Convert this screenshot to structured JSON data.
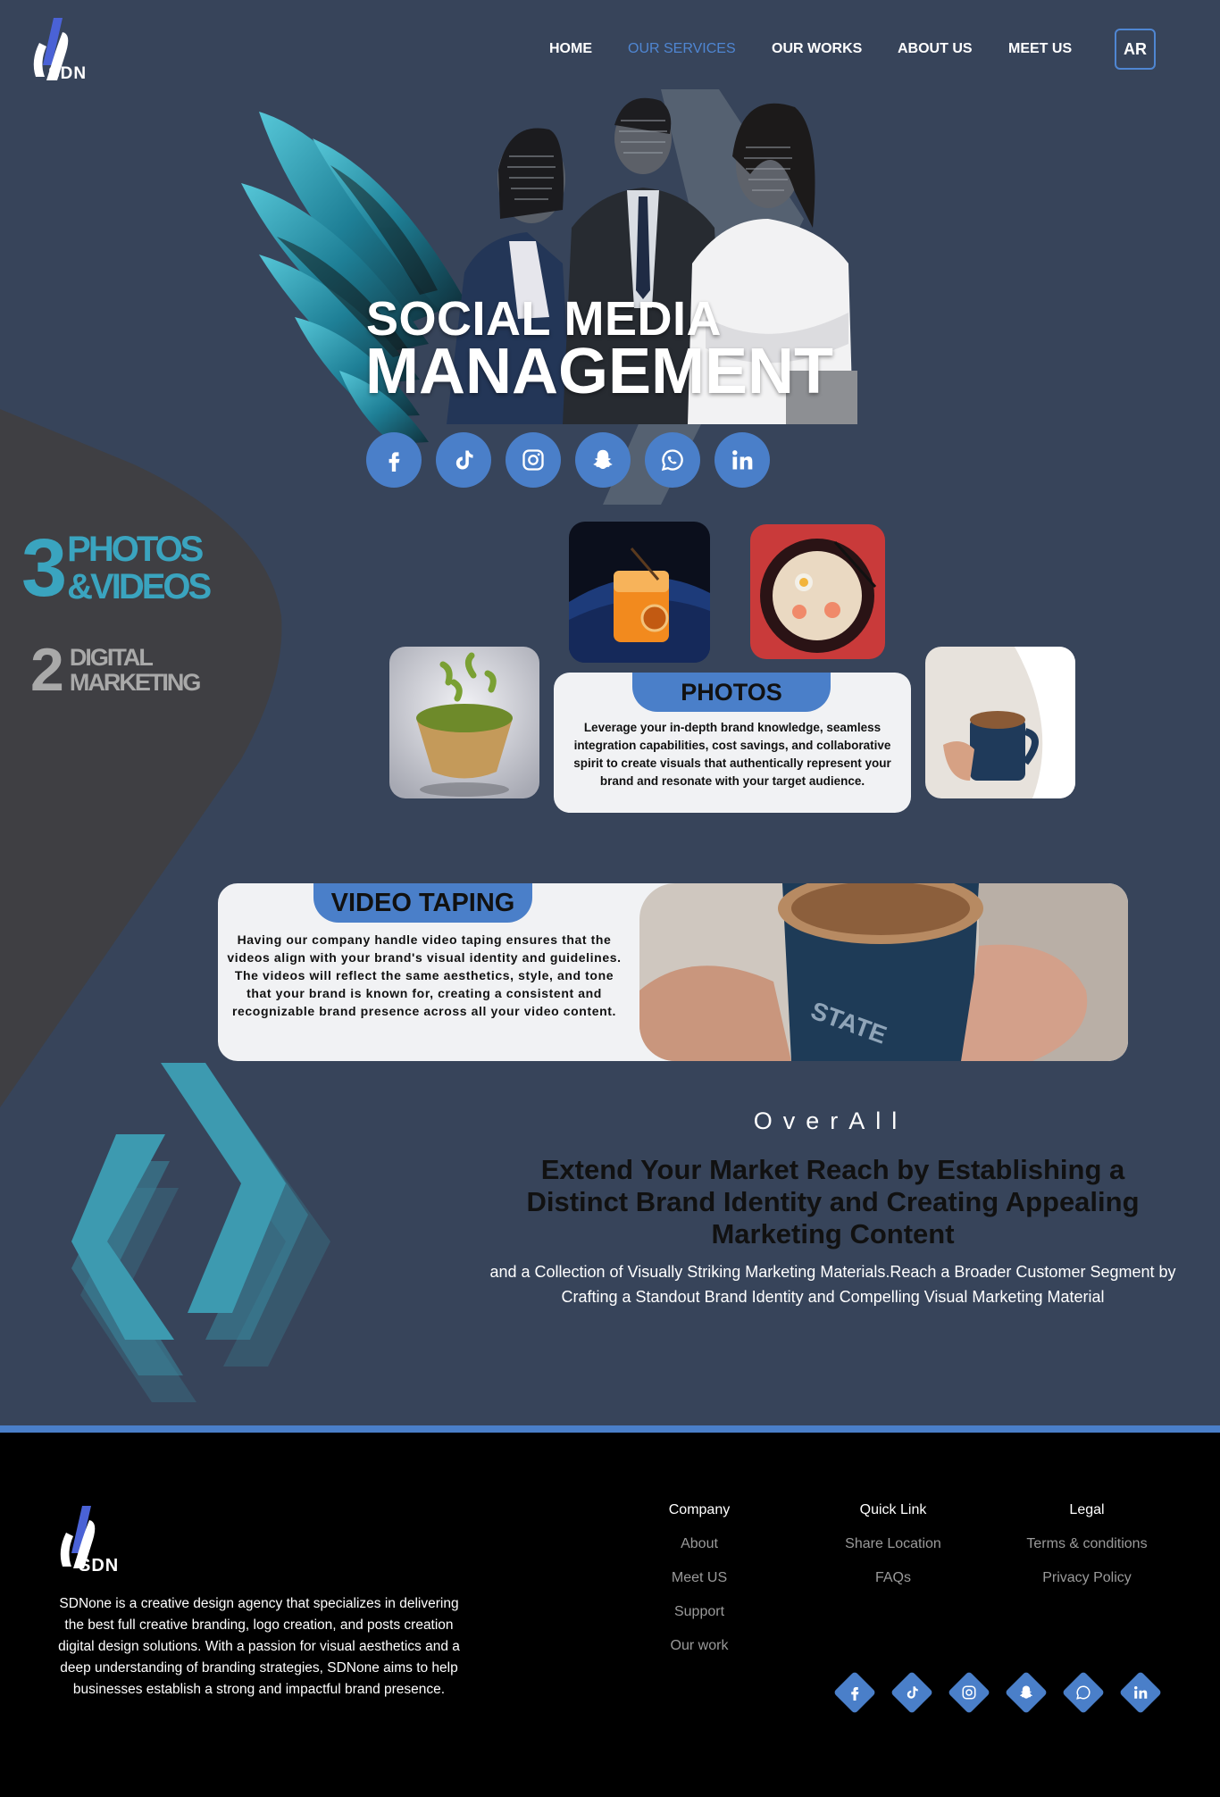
{
  "brand": {
    "logo_text": "SDN"
  },
  "nav": {
    "items": [
      "HOME",
      "OUR SERVICES",
      "OUR WORKS",
      "ABOUT US",
      "MEET US"
    ],
    "active": "OUR SERVICES",
    "lang_button": "AR"
  },
  "hero": {
    "title_line1": "SOCIAL MEDIA",
    "title_line2": "MANAGEMENT",
    "social_icons": [
      "facebook-icon",
      "tiktok-icon",
      "instagram-icon",
      "snapchat-icon",
      "whatsapp-icon",
      "linkedin-icon"
    ]
  },
  "counters": [
    {
      "number": "3",
      "label_line1": "PHOTOS",
      "label_line2": "&VIDEOS"
    },
    {
      "number": "2",
      "label_line1": "DIGITAL",
      "label_line2": "MARKETING"
    }
  ],
  "photos": {
    "title": "PHOTOS",
    "text": "Leverage your in-depth brand knowledge, seamless integration capabilities, cost savings, and collaborative spirit to create visuals that authentically represent your brand and resonate with your target audience."
  },
  "video": {
    "title": "VIDEO TAPING",
    "text": "Having our company handle video taping ensures that the videos align with your brand's visual identity and guidelines. The videos will reflect the same aesthetics, style, and tone that your brand is known for, creating a consistent and recognizable brand presence across all your video content."
  },
  "overall": {
    "kicker": "OverAll",
    "heading": "Extend Your Market Reach by Establishing a Distinct Brand Identity and Creating Appealing Marketing Content",
    "body": "and a Collection of Visually Striking Marketing Materials.Reach a Broader Customer Segment by Crafting a Standout Brand Identity and Compelling Visual Marketing Material"
  },
  "footer": {
    "logo_text": "SDN",
    "about": "SDNone is a creative design agency that specializes in delivering the best full creative branding, logo creation, and posts creation digital design solutions. With a passion for visual aesthetics and a deep understanding of branding strategies, SDNone aims to help businesses establish a strong and impactful brand presence.",
    "company": {
      "heading": "Company",
      "links": [
        "About",
        "Meet US",
        "Support",
        "Our work"
      ]
    },
    "quick": {
      "heading": "Quick Link",
      "links": [
        "Share Location",
        "FAQs"
      ]
    },
    "legal": {
      "heading": "Legal",
      "links": [
        "Terms & conditions",
        "Privacy Policy"
      ]
    }
  },
  "colors": {
    "background": "#37445a",
    "accent": "#4a7fc9",
    "teal": "#3aa4bf",
    "footer": "#000000"
  }
}
